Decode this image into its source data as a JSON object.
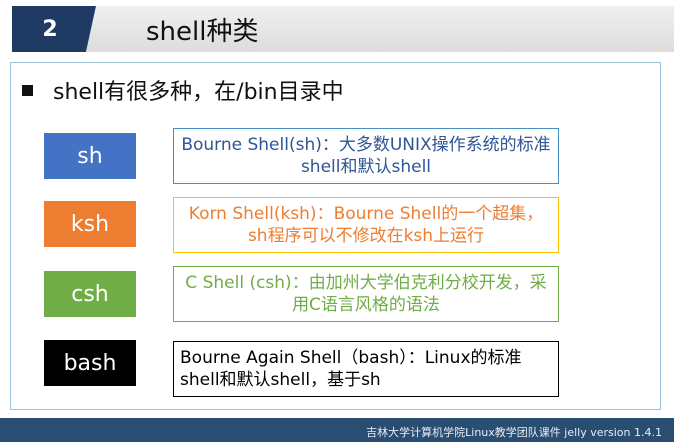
{
  "header": {
    "section_number": "2",
    "title": "shell种类"
  },
  "bullet": {
    "text": "shell有很多种，在/bin目录中"
  },
  "shells": [
    {
      "label": "sh",
      "description": "Bourne Shell(sh)：大多数UNIX操作系统的标准shell和默认shell",
      "label_color": "#4472c4",
      "text_color": "#2f5597",
      "border_color": "#4a90c8"
    },
    {
      "label": "ksh",
      "description": "Korn Shell(ksh)：Bourne Shell的一个超集，sh程序可以不修改在ksh上运行",
      "label_color": "#ed7d31",
      "text_color": "#ed7d31",
      "border_color": "#ffc000"
    },
    {
      "label": "csh",
      "description": "C Shell (csh)：由加州大学伯克利分校开发，采用C语言风格的语法",
      "label_color": "#70ad47",
      "text_color": "#70ad47",
      "border_color": "#70ad47"
    },
    {
      "label": "bash",
      "description": "Bourne Again Shell（bash）：Linux的标准shell和默认shell，基于sh",
      "label_color": "#000000",
      "text_color": "#000000",
      "border_color": "#000000"
    }
  ],
  "footer": {
    "text": "吉林大学计算机学院Linux教学团队课件 jelly version 1.4.1"
  }
}
